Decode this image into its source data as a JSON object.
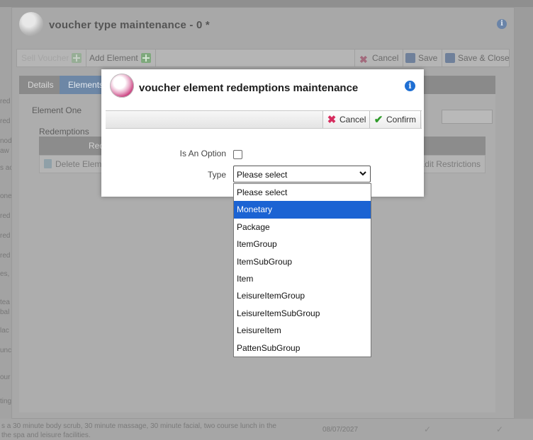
{
  "background_page": {
    "left_rows": [
      "red",
      "red",
      "nod",
      "aw",
      "s ac",
      "one",
      "red",
      "red",
      "red",
      "es,",
      "tea",
      "bal",
      "lac",
      "unc",
      "our",
      "ting"
    ],
    "bottom_text_line1": "s a 30 minute body scrub, 30 minute massage, 30 minute facial, two course lunch in the",
    "bottom_text_line2": "the spa and leisure facilities.",
    "bottom_date": "08/07/2027"
  },
  "outer_dialog": {
    "title": "voucher type maintenance - 0 *",
    "toolbar": {
      "sell_voucher": "Sell Voucher",
      "add_element": "Add Element",
      "cancel": "Cancel",
      "save": "Save",
      "save_close": "Save & Close"
    },
    "tabs": [
      "Details",
      "Elements"
    ],
    "element_label": "Element One",
    "redemptions_label": "Redemptions",
    "grid_header": "Red",
    "delete_element": "Delete Eleme",
    "edit_restrictions": "Edit Restrictions"
  },
  "dialog": {
    "title": "voucher element redemptions maintenance",
    "toolbar": {
      "cancel": "Cancel",
      "confirm": "Confirm"
    },
    "is_option_label": "Is An Option",
    "is_option_checked": false,
    "type_label": "Type",
    "type_value": "Please select"
  },
  "dropdown": {
    "options": [
      "Please select",
      "Monetary",
      "Package",
      "ItemGroup",
      "ItemSubGroup",
      "Item",
      "LeisureItemGroup",
      "LeisureItemSubGroup",
      "LeisureItem",
      "PattenSubGroup"
    ],
    "highlighted": "Monetary"
  },
  "colors": {
    "accent_blue": "#1b63d3",
    "cancel_red": "#d62d5f",
    "confirm_green": "#2f9b2a",
    "info_blue": "#1f6fd3"
  }
}
